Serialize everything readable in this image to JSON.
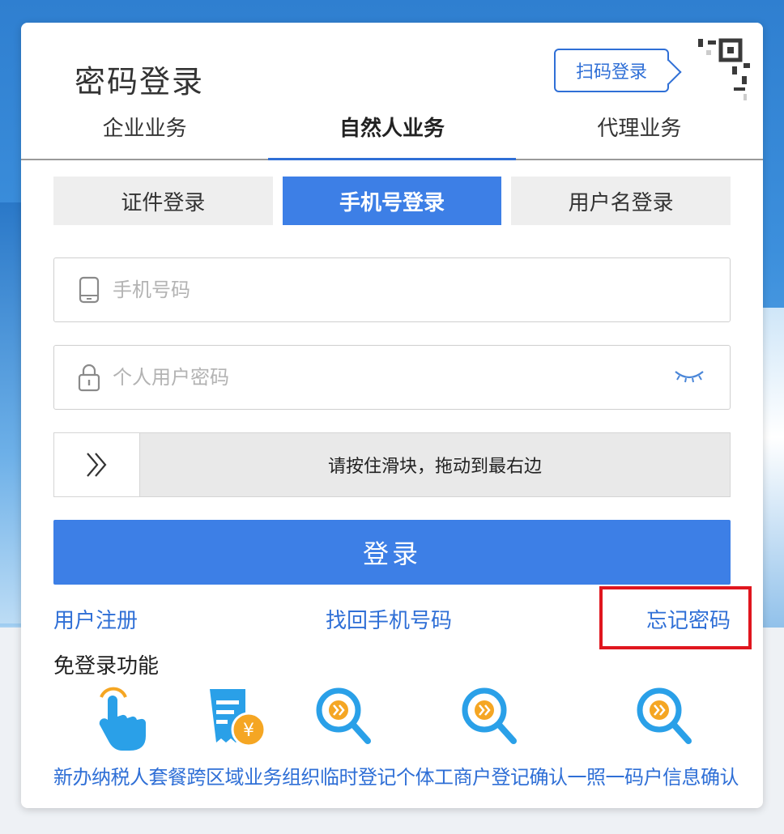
{
  "title": "密码登录",
  "scan_login_label": "扫码登录",
  "biz_tabs": [
    {
      "label": "企业业务"
    },
    {
      "label": "自然人业务"
    },
    {
      "label": "代理业务"
    }
  ],
  "login_tabs": [
    {
      "label": "证件登录"
    },
    {
      "label": "手机号登录"
    },
    {
      "label": "用户名登录"
    }
  ],
  "fields": {
    "phone_placeholder": "手机号码",
    "password_placeholder": "个人用户密码"
  },
  "slider_text": "请按住滑块，拖动到最右边",
  "login_button": "登录",
  "links": {
    "register": "用户注册",
    "recover_phone": "找回手机号码",
    "forgot_password": "忘记密码"
  },
  "nologin_title": "免登录功能",
  "quick_items": [
    {
      "label": "新办纳税人套餐",
      "icon": "touch-hand-icon"
    },
    {
      "label": "跨区域业务",
      "icon": "tax-receipt-yen-icon"
    },
    {
      "label": "组织临时登记",
      "icon": "search-magnifier-icon"
    },
    {
      "label": "个体工商户登记确认",
      "icon": "search-magnifier-icon"
    },
    {
      "label": "一照一码户信息确认",
      "icon": "search-magnifier-icon"
    }
  ],
  "colors": {
    "primary": "#3d7fe6",
    "link": "#2f6fd6",
    "highlight": "#e0161e",
    "accent_orange": "#f5a623"
  }
}
